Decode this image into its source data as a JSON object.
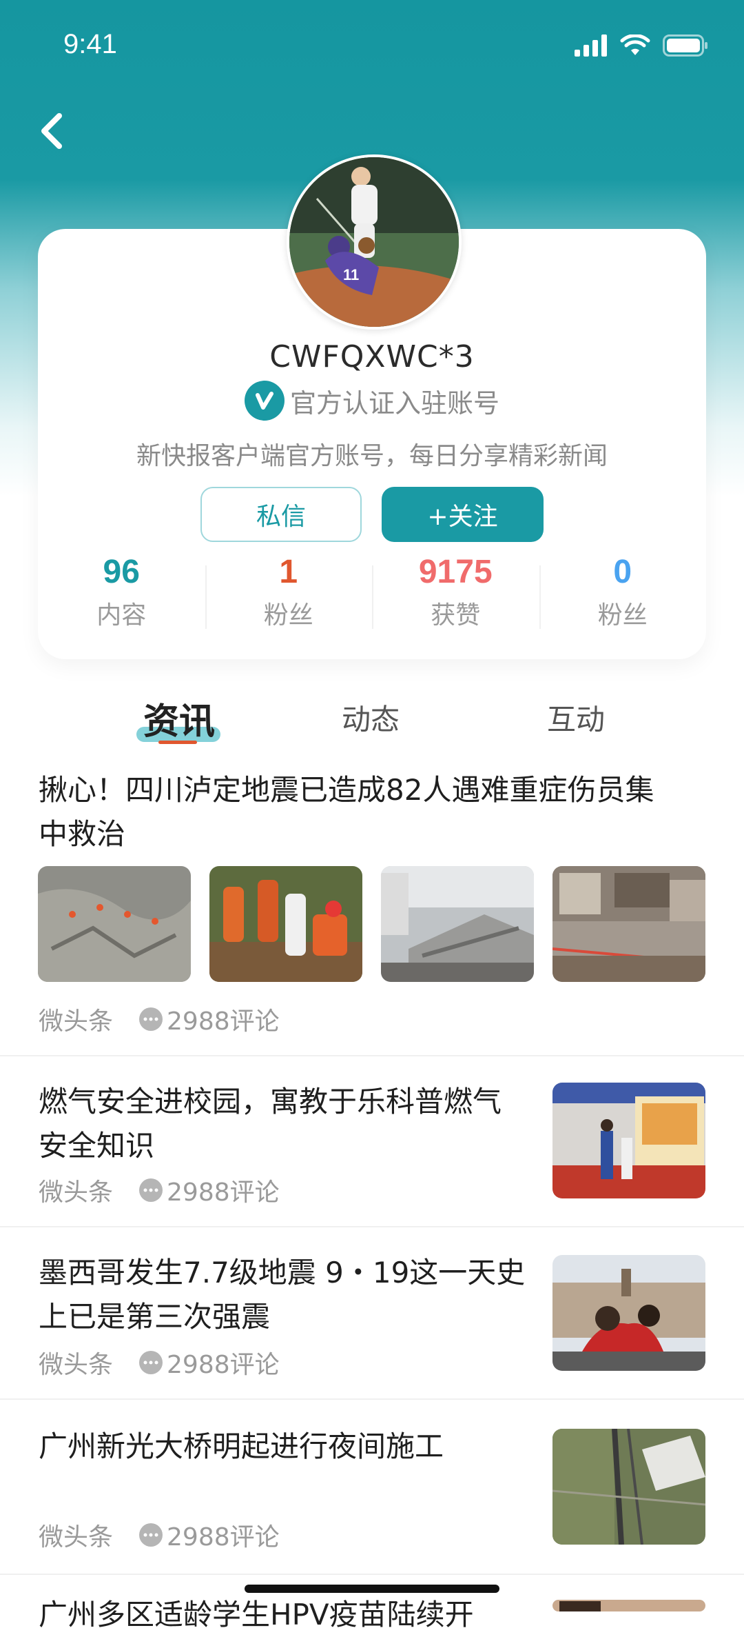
{
  "status_bar": {
    "time": "9:41"
  },
  "profile": {
    "username": "CWFQXWC*3",
    "verified_label": "官方认证入驻账号",
    "bio": "新快报客户端官方账号，每日分享精彩新闻",
    "message_button": "私信",
    "follow_button": "+关注"
  },
  "stats": [
    {
      "value": "96",
      "label": "内容",
      "color": "#1a9aa4"
    },
    {
      "value": "1",
      "label": "粉丝",
      "color": "#e0572f"
    },
    {
      "value": "9175",
      "label": "获赞",
      "color": "#f06b6b"
    },
    {
      "value": "0",
      "label": "粉丝",
      "color": "#4aa3f0"
    }
  ],
  "tabs": [
    {
      "label": "资讯",
      "active": true
    },
    {
      "label": "动态",
      "active": false
    },
    {
      "label": "互动",
      "active": false
    }
  ],
  "news": [
    {
      "title_line1": "揪心！四川泸定地震已造成82人遇难重症伤员集",
      "title_line2": "中救治",
      "source": "微头条",
      "comments": "2988评论"
    },
    {
      "title_line1": "燃气安全进校园，寓教于乐科普燃气",
      "title_line2": "安全知识",
      "source": "微头条",
      "comments": "2988评论"
    },
    {
      "title_line1": "墨西哥发生7.7级地震 9・19这一天史",
      "title_line2": "上已是第三次强震",
      "source": "微头条",
      "comments": "2988评论"
    },
    {
      "title_line1": "广州新光大桥明起进行夜间施工",
      "title_line2": "",
      "source": "微头条",
      "comments": "2988评论"
    },
    {
      "title_line1": "广州多区适龄学生HPV疫苗陆续开",
      "title_line2": "",
      "source": "",
      "comments": ""
    }
  ],
  "colors": {
    "brand": "#1a9aa4",
    "accent_underline": "#e0572f"
  }
}
